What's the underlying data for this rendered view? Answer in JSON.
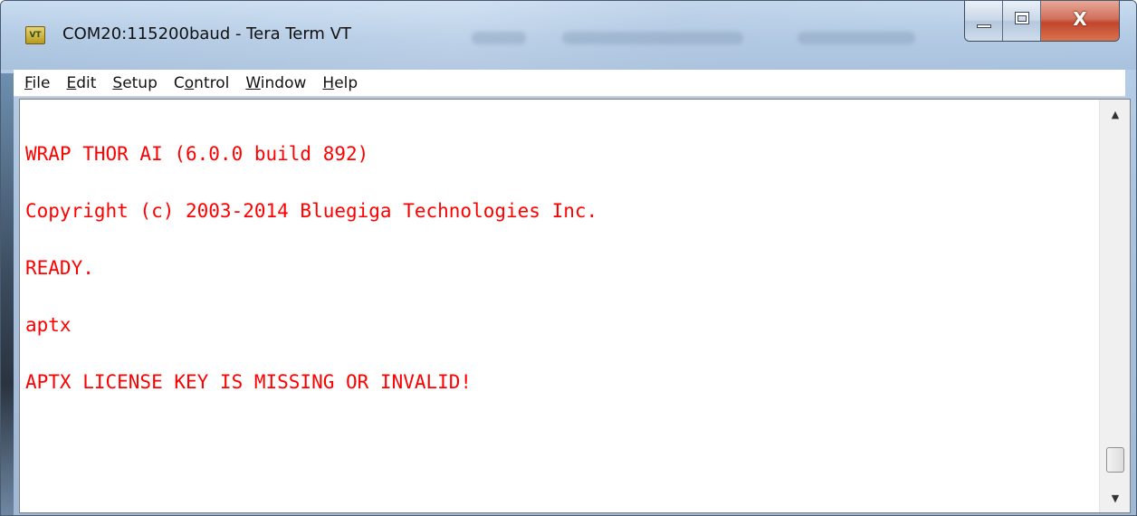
{
  "window": {
    "title": "COM20:115200baud - Tera Term VT",
    "icon_label": "VT",
    "icon": "tera-term-icon",
    "controls": {
      "minimize_icon": "minimize-icon",
      "maximize_icon": "maximize-icon",
      "close_glyph": "X"
    }
  },
  "menu": {
    "items": [
      {
        "accel": "F",
        "rest": "ile"
      },
      {
        "accel": "E",
        "rest": "dit"
      },
      {
        "accel": "S",
        "rest": "etup"
      },
      {
        "pre": "C",
        "accel": "o",
        "rest": "ntrol"
      },
      {
        "accel": "W",
        "rest": "indow"
      },
      {
        "accel": "H",
        "rest": "elp"
      }
    ]
  },
  "terminal": {
    "text_color": "#ff0000",
    "lines": [
      "WRAP THOR AI (6.0.0 build 892)",
      "Copyright (c) 2003-2014 Bluegiga Technologies Inc.",
      "READY.",
      "aptx",
      "APTX LICENSE KEY IS MISSING OR INVALID!"
    ]
  },
  "scrollbar": {
    "up_icon": "scroll-up-arrow-icon",
    "down_icon": "scroll-down-arrow-icon",
    "position_fraction": 1.0
  }
}
